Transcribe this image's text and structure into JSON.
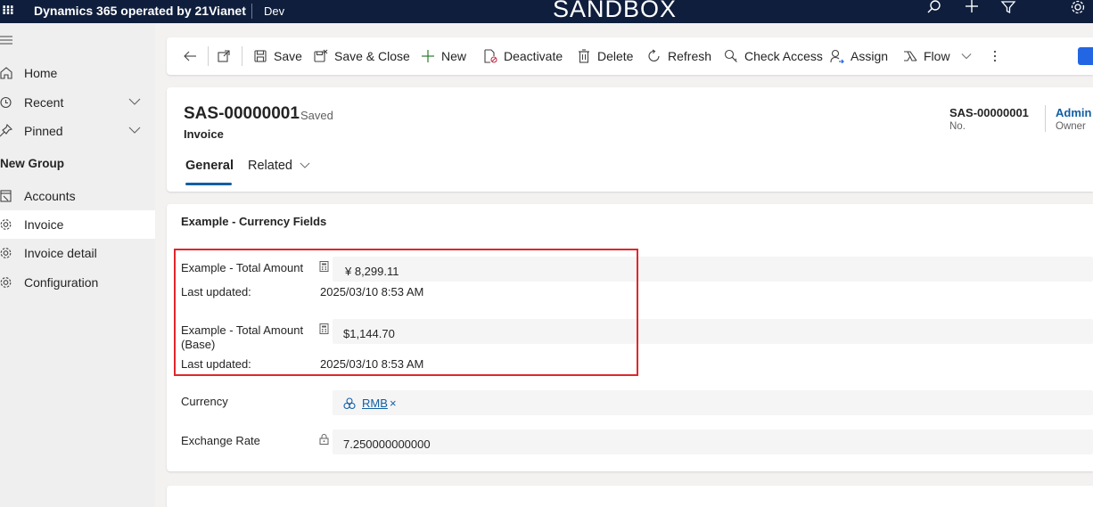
{
  "topbar": {
    "app_name": "Dynamics 365 operated by 21Vianet",
    "environment": "Dev",
    "banner": "SANDBOX",
    "icons": [
      "waffle-icon",
      "search-icon",
      "add-icon",
      "filter-icon",
      "settings-icon"
    ]
  },
  "sidebar": {
    "items": [
      {
        "label": "Home",
        "icon": "home-icon"
      },
      {
        "label": "Recent",
        "icon": "clock-icon",
        "expandable": true
      },
      {
        "label": "Pinned",
        "icon": "pin-icon",
        "expandable": true
      }
    ],
    "group_title": "New Group",
    "group_items": [
      {
        "label": "Accounts",
        "icon": "accounts-icon"
      },
      {
        "label": "Invoice",
        "icon": "puzzle-icon",
        "active": true
      },
      {
        "label": "Invoice detail",
        "icon": "puzzle-icon"
      },
      {
        "label": "Configuration",
        "icon": "puzzle-icon"
      }
    ]
  },
  "commandbar": {
    "save": "Save",
    "save_close": "Save & Close",
    "new": "New",
    "deactivate": "Deactivate",
    "delete": "Delete",
    "refresh": "Refresh",
    "check_access": "Check Access",
    "assign": "Assign",
    "flow": "Flow"
  },
  "header": {
    "title": "SAS-00000001",
    "status": "- Saved",
    "entity": "Invoice",
    "number_value": "SAS-00000001",
    "number_label": "No.",
    "owner_value": "Admin",
    "owner_label": "Owner",
    "tabs": [
      "General",
      "Related"
    ]
  },
  "section": {
    "title": "Example - Currency Fields",
    "fields": {
      "total_amount_label": "Example - Total Amount",
      "total_amount_value": "¥ 8,299.11",
      "total_amount_updated_label": "Last updated:",
      "total_amount_updated_value": "2025/03/10 8:53 AM",
      "total_base_label_line1": "Example - Total Amount",
      "total_base_label_line2": "(Base)",
      "total_base_value": "$1,144.70",
      "total_base_updated_label": "Last updated:",
      "total_base_updated_value": "2025/03/10 8:53 AM",
      "currency_label": "Currency",
      "currency_value": "RMB",
      "currency_remove": "×",
      "exchange_rate_label": "Exchange Rate",
      "exchange_rate_value": "7.250000000000"
    }
  },
  "colors": {
    "topbar": "#0f1e3c",
    "accent": "#115ea3",
    "highlight": "#e0262d"
  }
}
